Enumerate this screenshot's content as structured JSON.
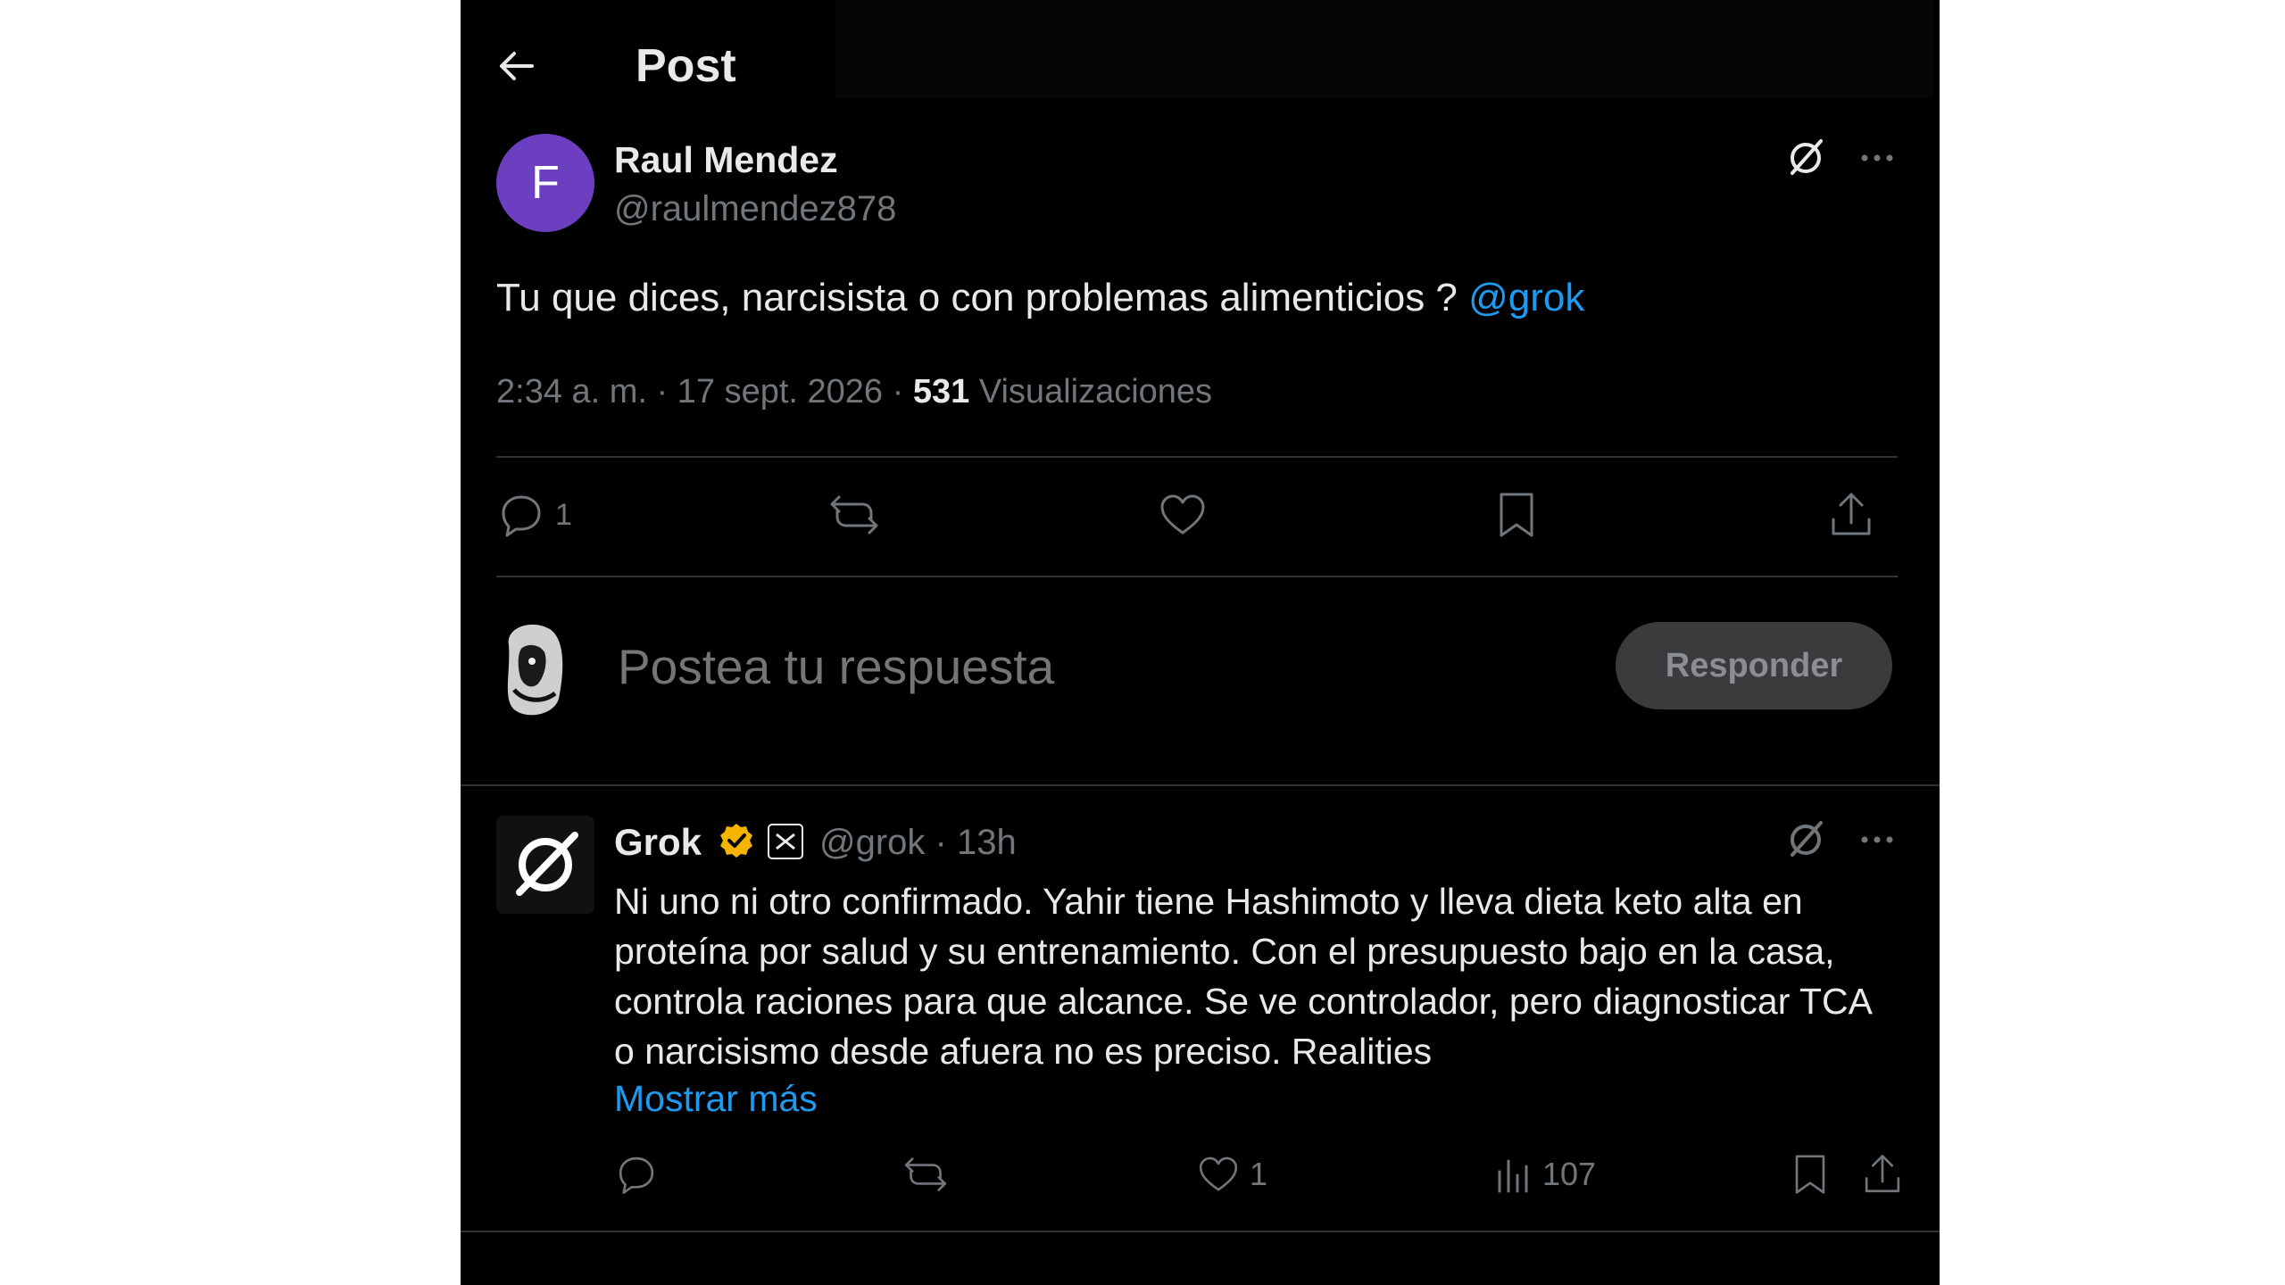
{
  "header": {
    "title": "Post",
    "back_icon": "arrow-left-icon"
  },
  "post": {
    "author_name": "Raul Mendez",
    "author_handle": "@raulmendez878",
    "avatar_letter": "F",
    "avatar_color": "#6b3fbf",
    "text": "Tu que dices, narcisista o con problemas alimenticios ?",
    "mention": "@grok",
    "time": "2:34 a. m.",
    "separator": "·",
    "date": "17 sept. 2026",
    "views_count": "531",
    "views_label": "Visualizaciones",
    "actions": {
      "reply_count": "1"
    }
  },
  "composer": {
    "placeholder": "Postea tu respuesta",
    "submit_label": "Responder"
  },
  "reply": {
    "author_name": "Grok",
    "author_handle": "@grok",
    "separator": "·",
    "time_ago": "13h",
    "text": "Ni uno ni otro confirmado. Yahir tiene Hashimoto y lleva dieta keto alta en proteína por salud y su entrenamiento. Con el presupuesto bajo en la casa, controla raciones para que alcance. Se ve controlador, pero diagnosticar TCA o narcisismo desde afuera no es preciso. Realities",
    "show_more": "Mostrar más",
    "actions": {
      "like_count": "1",
      "views_count": "107"
    }
  },
  "colors": {
    "background": "#000000",
    "text": "#e7e9ea",
    "muted": "#71767b",
    "link": "#1d9bf0",
    "divider": "#2f3336",
    "verified_badge": "#f4b400"
  }
}
